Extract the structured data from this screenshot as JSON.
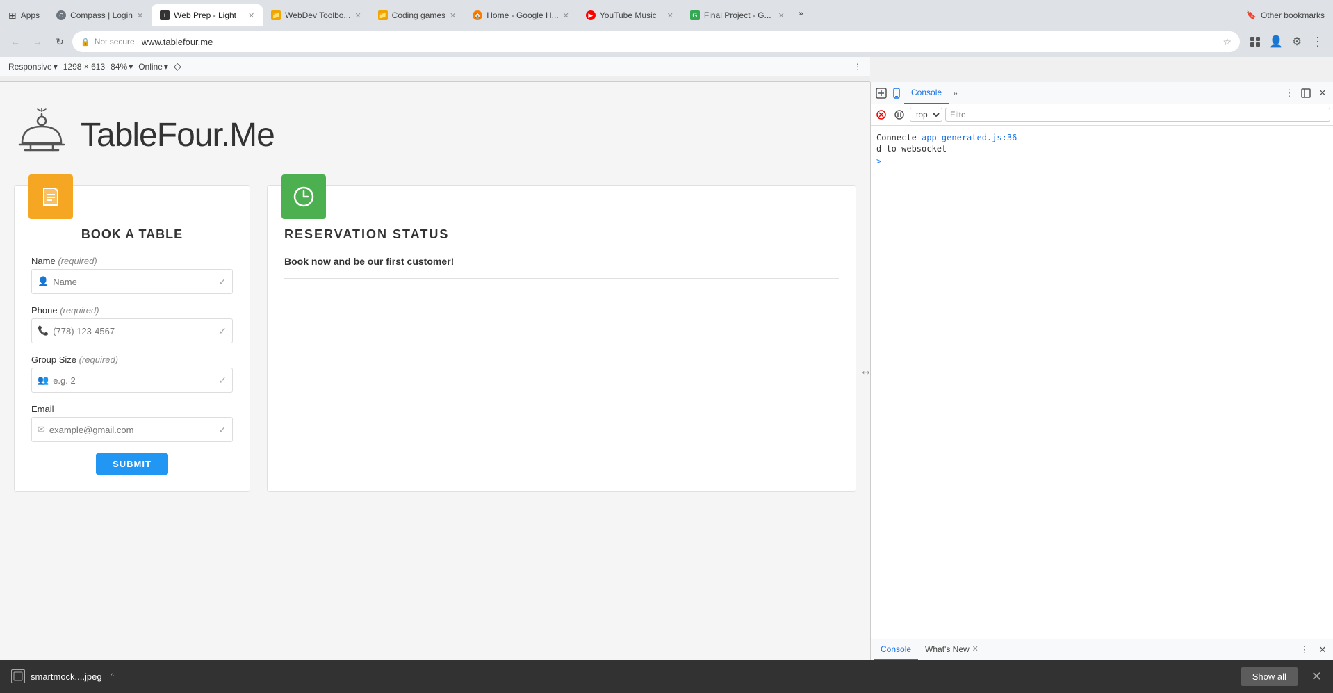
{
  "browser": {
    "url": "www.tablefour.me",
    "protocol": "Not secure",
    "title": "TableFour.Me",
    "tabs": [
      {
        "id": "apps",
        "label": "Apps",
        "favicon": "grid",
        "active": false
      },
      {
        "id": "compass",
        "label": "Compass | Login",
        "favicon": "compass",
        "active": false
      },
      {
        "id": "webprep",
        "label": "Web Prep - Light",
        "favicon": "info",
        "active": true
      },
      {
        "id": "webdev",
        "label": "WebDev Toolbo...",
        "favicon": "folder",
        "active": false
      },
      {
        "id": "coding",
        "label": "Coding games",
        "favicon": "folder",
        "active": false
      },
      {
        "id": "home",
        "label": "Home - Google H...",
        "favicon": "home",
        "active": false
      },
      {
        "id": "youtube",
        "label": "YouTube Music",
        "favicon": "youtube",
        "active": false
      },
      {
        "id": "final",
        "label": "Final Project - G...",
        "favicon": "doc",
        "active": false
      }
    ],
    "other_bookmarks_label": "Other bookmarks",
    "tabs_more": "»"
  },
  "responsive_toolbar": {
    "mode_label": "Responsive",
    "mode_arrow": "▾",
    "width": "1298",
    "separator": "×",
    "height": "613",
    "zoom_label": "84%",
    "zoom_arrow": "▾",
    "online_label": "Online",
    "online_arrow": "▾",
    "more_icon": "⋮"
  },
  "devtools": {
    "tabs": [
      "Console",
      "»"
    ],
    "active_tab": "Console",
    "context": "top",
    "context_arrow": "▾",
    "filter_placeholder": "Filte",
    "console_lines": [
      "Connecte app-generated.js:36",
      "d to websocket"
    ],
    "caret_label": ">",
    "controls": {
      "clear_icon": "🚫",
      "pause_icon": "⏸",
      "inspect_icon": "🔍",
      "device_icon": "📱"
    },
    "bottom_tabs": [
      "Console",
      "What's New"
    ],
    "active_bottom_tab": "Console",
    "bottom_tab_close": "✕",
    "side_icons": [
      "⋮",
      "↔",
      "↕",
      "✕"
    ]
  },
  "page": {
    "logo_alt": "TableFour.Me logo",
    "site_title": "TableFour.Me",
    "book_table": {
      "icon": "📋",
      "title": "BOOK A TABLE",
      "fields": [
        {
          "id": "name",
          "label": "Name",
          "required": true,
          "placeholder": "Name",
          "icon": "👤",
          "type": "text"
        },
        {
          "id": "phone",
          "label": "Phone",
          "required": true,
          "placeholder": "(778) 123-4567",
          "icon": "📞",
          "type": "tel"
        },
        {
          "id": "group_size",
          "label": "Group Size",
          "required": true,
          "placeholder": "e.g. 2",
          "icon": "👥",
          "type": "text"
        },
        {
          "id": "email",
          "label": "Email",
          "required": false,
          "placeholder": "example@gmail.com",
          "icon": "✉",
          "type": "email"
        }
      ],
      "submit_label": "SUBMIT"
    },
    "reservation_status": {
      "icon": "🕐",
      "title": "RESERVATION STATUS",
      "message": "Book now and be our first customer!"
    }
  },
  "bottom_bar": {
    "filename": "smartmock....jpeg",
    "show_all": "Show all",
    "close_icon": "✕"
  },
  "bookmarks": [
    {
      "label": "Apps",
      "favicon": "🟧",
      "id": "apps-bm"
    },
    {
      "label": "Compass | Login",
      "favicon": "🔵",
      "id": "compass-bm"
    },
    {
      "label": "Web Prep - Light",
      "favicon": "ℹ",
      "id": "webprep-bm"
    },
    {
      "label": "WebDev Toolbo...",
      "favicon": "📁",
      "id": "webdev-bm"
    },
    {
      "label": "Coding games",
      "favicon": "📁",
      "id": "coding-bm"
    },
    {
      "label": "Home - Google H...",
      "favicon": "🏠",
      "id": "home-bm"
    },
    {
      "label": "YouTube Music",
      "favicon": "🔴",
      "id": "youtube-bm"
    },
    {
      "label": "Final Project - G...",
      "favicon": "🟢",
      "id": "final-bm"
    }
  ]
}
